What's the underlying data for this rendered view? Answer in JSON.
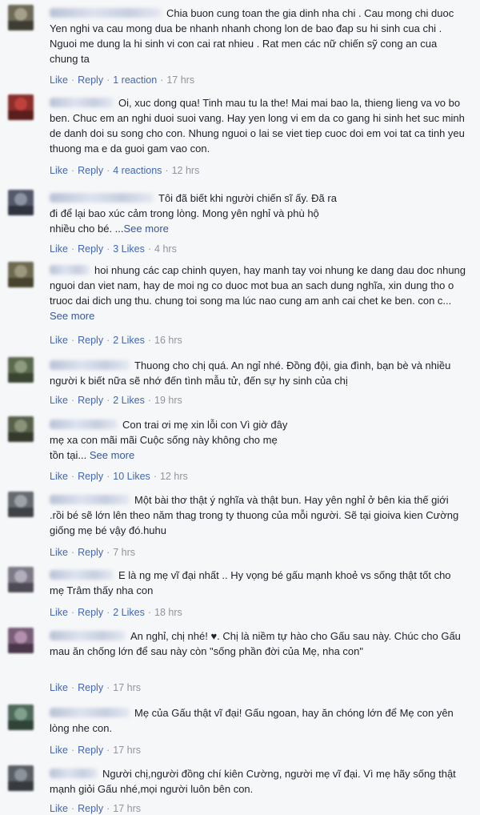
{
  "actions": {
    "like": "Like",
    "reply": "Reply",
    "see_more": "See more"
  },
  "comments": [
    {
      "text": "Chia buon cung toan the gia dinh nha chi . Cau mong chi duoc Yen nghi va cau mong dua be nhanh nhanh chong lon de bao đap su hi sinh cua chi . Nguoi me dung la hi sinh vi con cai rat nhieu . Rat men các nữ chiến sỹ cong an cua chung ta",
      "reactions": "1 reaction",
      "time": "17 hrs",
      "avatar_colors": [
        "#6e6a58",
        "#a5a08a",
        "#3f3d33"
      ]
    },
    {
      "text": "Oi, xuc dong qua! Tinh mau tu la the! Mai mai bao la, thieng lieng va vo bo ben. Chuc em an nghi duoi suoi vang. Hay yen long vi em da co gang hi sinh het suc minh de danh doi su song cho con. Nhung nguoi o lai se viet tiep cuoc doi em voi tat ca tinh yeu thuong ma e da guoi gam vao con.",
      "reactions": "4 reactions",
      "time": "12 hrs",
      "avatar_colors": [
        "#8b2f2b",
        "#c0413b",
        "#5a1e1c"
      ]
    },
    {
      "text": "Tôi đã biết khi người chiến sĩ ấy. Đã ra đi để lại bao xúc cảm trong lòng. Mong yên nghỉ và phù hộ nhiều cho bé. ...",
      "more": true,
      "reactions": "3 Likes",
      "time": "4 hrs",
      "avatar_colors": [
        "#53596a",
        "#8c93a3",
        "#2f3440"
      ]
    },
    {
      "text": "hoi nhung các cap chinh quyen, hay manh tay voi nhung ke dang dau doc nhung nguoi dan viet nam, hay de moi ng co duoc mot bua an sach dung nghĩa, xin dung tho o truoc dai dich ung thu. chung toi song ma lúc nao cung am anh cai chet ke ben. con c...",
      "more": true,
      "reactions": "2 Likes",
      "time": "16 hrs",
      "avatar_colors": [
        "#6d6a52",
        "#9c987c",
        "#46442f"
      ]
    },
    {
      "text": "Thuong cho chị quá. An ngỉ nhé. Đồng đội, gia đình, bạn bè và nhiều người k biết nữa sẽ nhớ đến tình mẫu tử, đến sự hy sinh của chị",
      "reactions": "2 Likes",
      "time": "19 hrs",
      "avatar_colors": [
        "#5b6a4e",
        "#8e9b7c",
        "#3a4532"
      ]
    },
    {
      "text": "Con trai ơi mẹ xin lỗi con Vì giờ đây mẹ xa con mãi mãi Cuộc sống này không cho mẹ tồn tại...",
      "more": true,
      "reactions": "10 Likes",
      "time": "12 hrs",
      "avatar_colors": [
        "#57614a",
        "#8a9378",
        "#343a2c"
      ]
    },
    {
      "text": "Một bài thơ thật ý nghĩa và thật bun. Hay yên nghỉ ở bên kia thế giới .rồi bé sẽ lớn lên theo năm thag trong ty thuong của mỗi người. Sẽ tại gioiva kien Cường giống mẹ bé vậy đó.huhu",
      "reactions": "",
      "time": "7 hrs",
      "avatar_colors": [
        "#656a70",
        "#9da2a8",
        "#3e4247"
      ]
    },
    {
      "text": "E là ng mẹ vĩ đại nhất .. Hy vọng bé gấu mạnh khoẻ vs sống thật tốt cho mẹ Trâm thấy nha con",
      "reactions": "2 Likes",
      "time": "18 hrs",
      "avatar_colors": [
        "#7e7986",
        "#b3aebb",
        "#4f4b56"
      ]
    },
    {
      "text": "An nghỉ, chị nhé! ♥. Chị là niềm tự hào cho Gấu sau này. Chúc cho Gấu mau ăn chống lớn để sau này còn \"sống phần đời của Mẹ, nha con\"",
      "reactions": "",
      "time": "17 hrs",
      "avatar_colors": [
        "#7a5e78",
        "#b38fb0",
        "#4a3749"
      ]
    },
    {
      "text": "Mẹ của Gấu thật vĩ đại! Gấu ngoan, hay ăn chóng lớn để Mẹ con yên lòng nhe con.",
      "reactions": "",
      "time": "17 hrs",
      "avatar_colors": [
        "#4e6a5a",
        "#7fa08c",
        "#2f4337"
      ]
    },
    {
      "text": "Người chị,người đồng chí kiên Cường, người mẹ vĩ đại. Vì mẹ hãy sống thật mạnh giỏi Gấu nhé,mọi người luôn bên con.",
      "reactions": "",
      "time": "17 hrs",
      "avatar_colors": [
        "#5a5f66",
        "#8d939b",
        "#373b40"
      ]
    }
  ]
}
